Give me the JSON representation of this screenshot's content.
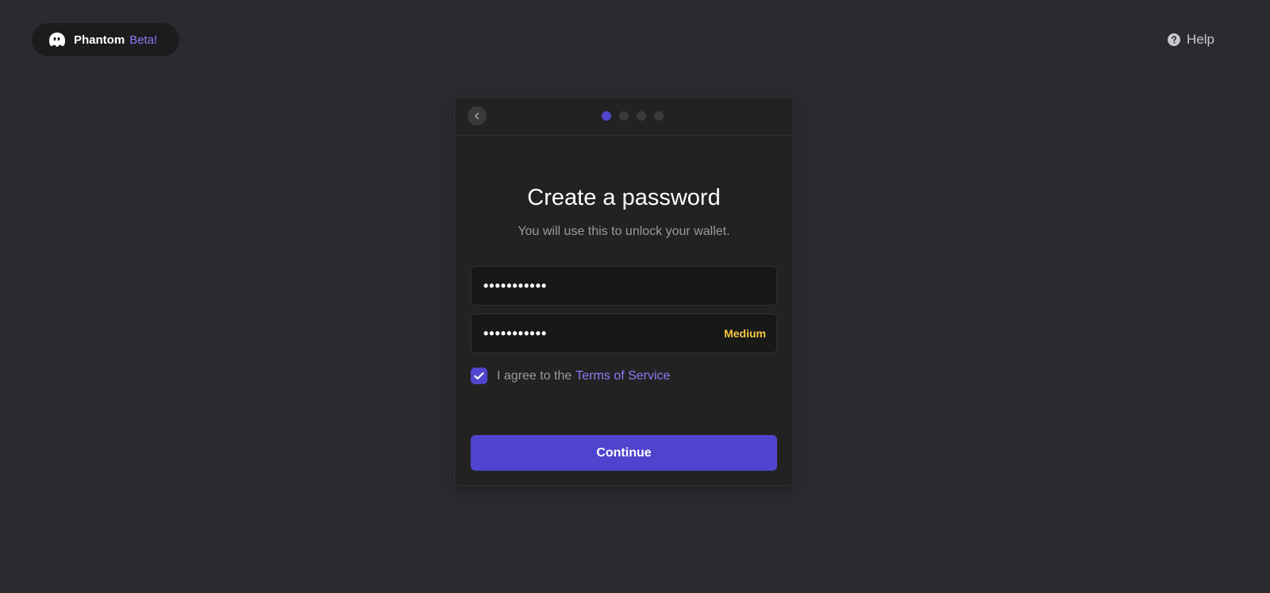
{
  "brand": {
    "name": "Phantom",
    "badge": "Beta!",
    "accent_color": "#8b7cf7",
    "icon": "ghost-icon"
  },
  "header": {
    "help_label": "Help",
    "help_icon": "question-circle-icon"
  },
  "card": {
    "back_icon": "chevron-left-icon",
    "progress": {
      "total_steps": 4,
      "current_step": 1
    },
    "title": "Create a password",
    "subtitle": "You will use this to unlock your wallet.",
    "password_field": {
      "value": "•••••••••••"
    },
    "confirm_field": {
      "value": "•••••••••••",
      "strength_label": "Medium",
      "strength_color": "#f5c542"
    },
    "terms": {
      "checked": true,
      "prefix": "I agree to the",
      "link_label": "Terms of Service"
    },
    "continue_label": "Continue",
    "button_color": "#4e44ce"
  }
}
